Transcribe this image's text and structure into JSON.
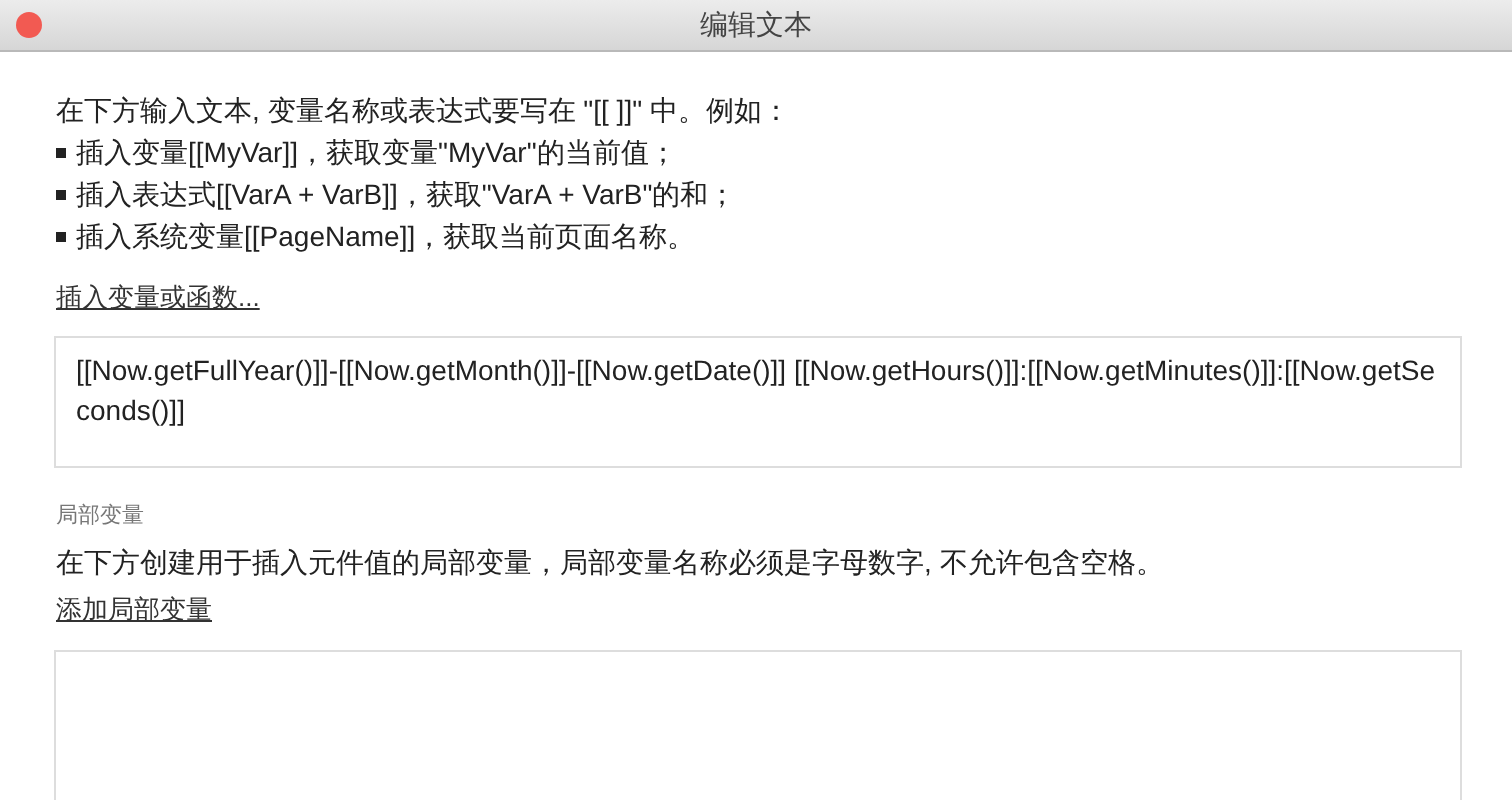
{
  "window": {
    "title": "编辑文本"
  },
  "intro": "在下方输入文本, 变量名称或表达式要写在 \"[[ ]]\" 中。例如：",
  "bullets": [
    "插入变量[[MyVar]]，获取变量\"MyVar\"的当前值；",
    "插入表达式[[VarA + VarB]]，获取\"VarA + VarB\"的和；",
    "插入系统变量[[PageName]]，获取当前页面名称。"
  ],
  "insert_link": "插入变量或函数...",
  "text_field": {
    "value": "[[Now.getFullYear()]]-[[Now.getMonth()]]-[[Now.getDate()]] [[Now.getHours()]]:[[Now.getMinutes()]]:[[Now.getSeconds()]]"
  },
  "local_variables": {
    "heading": "局部变量",
    "description": "在下方创建用于插入元件值的局部变量，局部变量名称必须是字母数字, 不允许包含空格。",
    "add_link": "添加局部变量"
  }
}
